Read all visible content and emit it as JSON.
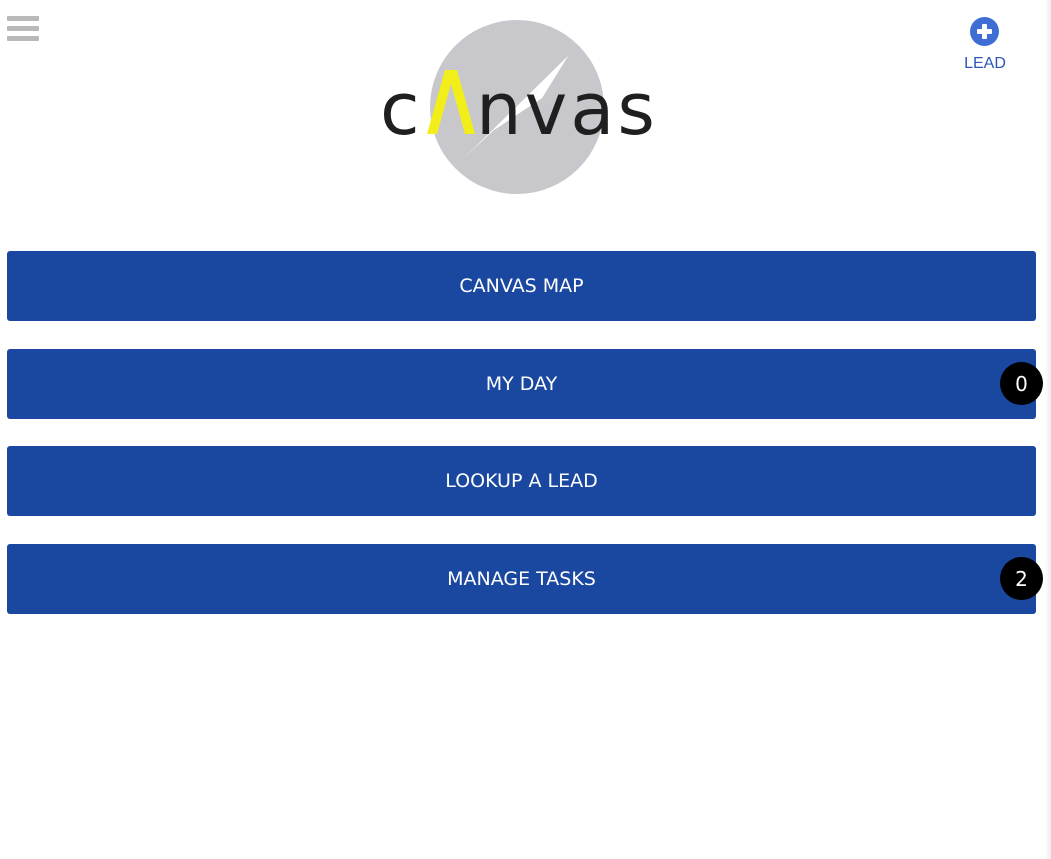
{
  "app": {
    "logo_text": "canvas"
  },
  "header": {
    "menu_icon": "hamburger-menu-icon",
    "add_lead": {
      "icon": "plus-circle-icon",
      "label": "LEAD"
    }
  },
  "menu": {
    "buttons": [
      {
        "label": "CANVAS MAP"
      },
      {
        "label": "MY DAY",
        "badge": "0"
      },
      {
        "label": "LOOKUP A LEAD"
      },
      {
        "label": "MANAGE TASKS",
        "badge": "2"
      }
    ]
  },
  "colors": {
    "button_bg": "#1a48a1",
    "button_text": "#ffffff",
    "badge_bg": "#000000",
    "accent_blue": "#3e6ed3",
    "logo_circle": "#c8c8cc",
    "logo_accent": "#f2ee1a",
    "logo_text": "#1f1f1f"
  }
}
